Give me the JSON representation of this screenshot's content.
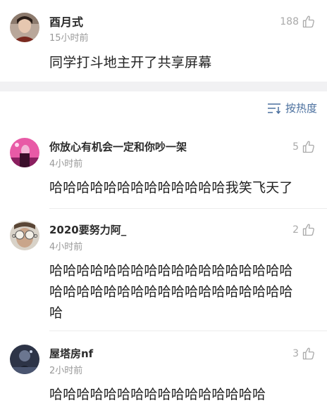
{
  "post": {
    "username": "酉月式",
    "time": "15小时前",
    "likes": "188",
    "content": "同学打斗地主开了共享屏幕"
  },
  "sort": {
    "label": "按热度"
  },
  "comments": [
    {
      "username": "你放心有机会一定和你吵一架",
      "time": "4小时前",
      "likes": "5",
      "lines": [
        "哈哈哈哈哈哈哈哈哈哈哈哈哈我笑飞天了"
      ]
    },
    {
      "username": "2020要努力阿_",
      "time": "4小时前",
      "likes": "2",
      "lines": [
        "哈哈哈哈哈哈哈哈哈哈哈哈哈哈哈哈哈哈",
        "哈哈哈哈哈哈哈哈哈哈哈哈哈哈哈哈哈哈",
        "哈"
      ]
    },
    {
      "username": "屋塔房nf",
      "time": "2小时前",
      "likes": "3",
      "lines": [
        "哈哈哈哈哈哈哈哈哈哈哈哈哈哈哈哈"
      ]
    }
  ],
  "icons": {
    "like": "thumbs-up-icon",
    "sort": "sort-lines-icon"
  },
  "colors": {
    "link": "#4a6f9e",
    "muted": "#999999",
    "band": "#f1f1f3"
  }
}
